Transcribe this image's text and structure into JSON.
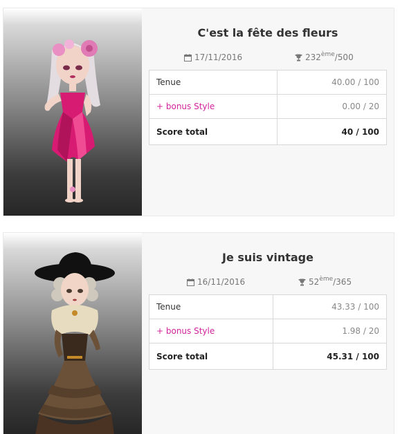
{
  "contests": [
    {
      "title": "C'est la fête des fleurs",
      "date": "17/11/2016",
      "rank": "232",
      "rank_suffix": "ème",
      "rank_total": "/500",
      "rows": {
        "tenue_label": "Tenue",
        "tenue_value": "40.00 / 100",
        "bonus_label": "+ bonus Style",
        "bonus_value": "0.00 / 20",
        "total_label": "Score total",
        "total_value": "40 / 100"
      },
      "colors": {
        "dress": "#d81b72",
        "hair": "#e8e2e6",
        "flowers": "#e98fc3"
      }
    },
    {
      "title": "Je suis vintage",
      "date": "16/11/2016",
      "rank": "52",
      "rank_suffix": "ème",
      "rank_total": "/365",
      "rows": {
        "tenue_label": "Tenue",
        "tenue_value": "43.33 / 100",
        "bonus_label": "+ bonus Style",
        "bonus_value": "1.98 / 20",
        "total_label": "Score total",
        "total_value": "45.31 / 100"
      },
      "colors": {
        "dress": "#6b5138",
        "hat": "#111111",
        "fur": "#e8dcc0"
      }
    }
  ],
  "icons": {
    "date": "calendar-icon",
    "rank": "trophy-icon"
  },
  "accent_bonus_color": "#d2239b"
}
